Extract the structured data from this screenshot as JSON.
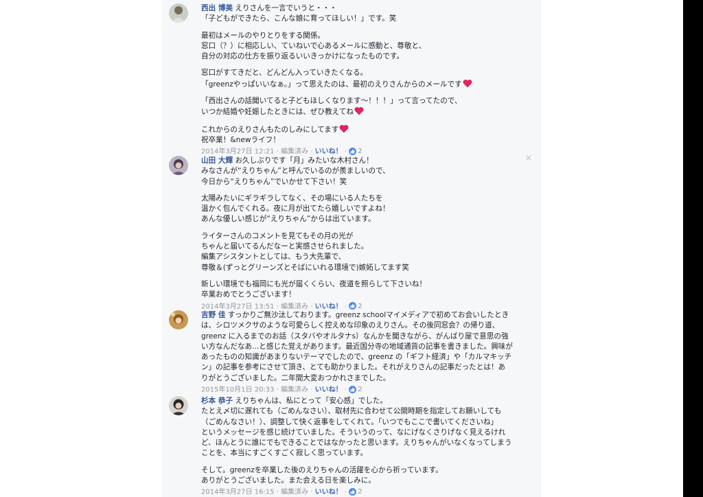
{
  "comments": [
    {
      "author": "西出 博美",
      "lines": [
        "えりさんを一言でいうと・・・",
        "「子どもができたら、こんな娘に育ってほしい！」です。笑",
        "",
        "最初はメールのやりとりをする関係。",
        "窓口（？）に相応しい、ていねいで心あるメールに感動と、尊敬と、",
        "自分の対応の仕方を振り返るいいきっかけになったものです。",
        "",
        "窓口がすてきだと、どんどん入っていきたくなる。",
        "「greenzやっぱいいなぁ。」って思えたのは、最初のえりさんからのメールです",
        "",
        "「西出さんの話聞いてると子どもほしくなります〜！！！」って言ってたので、",
        "いつか結婚や妊娠したときには、ぜひ教えてね",
        "",
        "これからのえりさんもたのしみにしてます",
        "祝卒業！&newライフ！"
      ],
      "timestamp": "2014年3月27日 12:21",
      "edited": "編集済み",
      "like_label": "いいね！",
      "like_count": "2"
    },
    {
      "author": "山田 大輝",
      "lines": [
        "お久しぶりです「月」みたいな木村さん！",
        "みなさんが“えりちゃん”と呼んでいるのが羨ましいので、",
        "今日から“えりちゃん”でいかせて下さい！笑",
        "",
        "太陽みたいにギラギラしてなく、その場にいる人たちを",
        "温かく包んでくれる。夜に月が出てたら嬉しいですよね！",
        "あんな優しい感じが“えりちゃん”からは出ています。",
        "",
        "ライターさんのコメントを見てもその月の光が",
        "ちゃんと届いてるんだなーと実感させられました。",
        "編集アシスタントとしては、もう大先輩で、",
        "尊敬＆(ずっとグリーンズとそばにいれる環境で)嫉妬してます笑",
        "",
        "新しい環境でも福岡にも光が届くくらい、夜道を照らして下さいね！",
        "卒業おめでとうございます！"
      ],
      "timestamp": "2014年3月27日 13:51",
      "edited": "編集済み",
      "like_label": "いいね！",
      "like_count": "2"
    },
    {
      "author": "吉野 佳",
      "lines": [
        "すっかりご無沙汰しております。greenz schoolマイメディアで初めてお会いしたとき",
        "は、シロツメクサのような可愛らしく控えめな印象のえりさん。その後同窓会？の帰り道、",
        "greenz に入るまでのお話（スタバやオルタナs）なんかを聞きながら、がんばり屋で意思の強",
        "い方なんだなあ...と感じた覚えがあります。最近国分寺の地域通貨の記事を書きました。興味が",
        "あったものの知識があまりないテーマでしたので、greenz の「ギフト経済」や「カルマキッチ",
        "ン」の記事を参考にさせて頂き、とても助かりました。それがえりさんの記事だったとは！あ",
        "りがとうございました。二年間大変おつかれさまでした。"
      ],
      "timestamp": "2015年10月1日 20:33",
      "edited": "編集済み",
      "like_label": "いいね！",
      "like_count": "2"
    },
    {
      "author": "杉本 恭子",
      "lines": [
        "えりちゃんは、私にとって「安心感」でした。",
        "たとえ〆切に遅れても（ごめんなさい）、取材先に合わせて公開時期を指定してお願いしても",
        "（ごめんなさい！）、調整して快く返事をしてくれて。「いつでもここで書いてくださいね」",
        "というメッセージを感じ続けていました。そういうのって、なにげなくさりげなく見えるけれ",
        "ど、ほんとうに誰にでもできることではなかったと思います。えりちゃんがいなくなってしまう",
        "ことを、本当にすごくすごく寂しく思っています。",
        "",
        "そして。greenzを卒業した後のえりちゃんの活躍を心から祈っています。",
        "ありがとうございました。また会える日を楽しみに。"
      ],
      "timestamp": "2014年3月27日 16:15",
      "edited": "編集済み",
      "like_label": "いいね！",
      "like_count": "2"
    }
  ],
  "separator": "·",
  "close_glyph": "×",
  "colors": {
    "author_link": "#365899",
    "like_link": "#4267b2",
    "meta_text": "#90949c",
    "heart": "#e0245e",
    "feed_background": "#f6f7f9"
  }
}
